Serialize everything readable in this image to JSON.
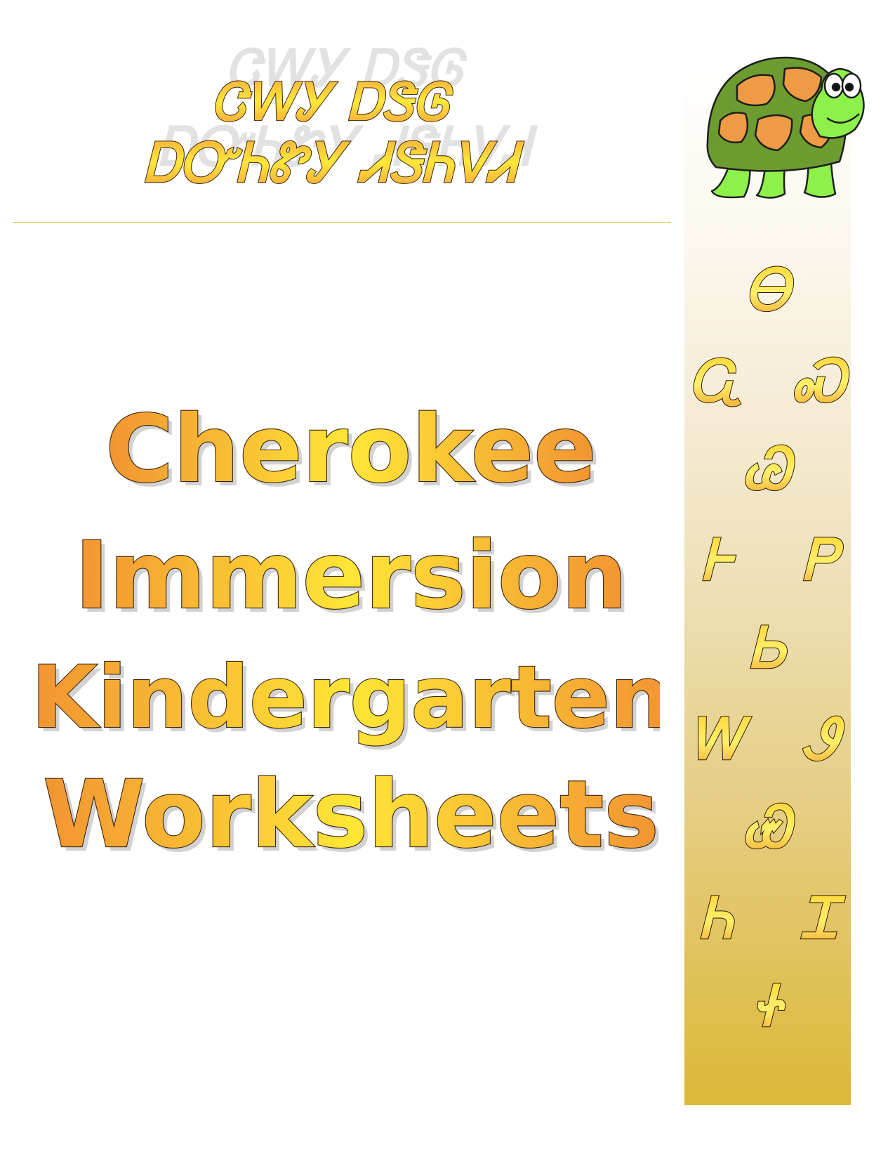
{
  "header": {
    "line1": "ᏣᎳᎩ ᎠᏕᎶ",
    "line2": "ᎠᏅᏂᏑᎩ ᏗᏕᏂᏙᏗ"
  },
  "title": {
    "line1": "Cherokee",
    "line2": "Immersion",
    "line3": "Kindergarten",
    "line4": "Worksheets"
  },
  "sidebar": {
    "glyphs": [
      "Ꮎ",
      "Ꮹ",
      "Ꮝ",
      "Ꮚ",
      "Ꮀ",
      "Ꮲ",
      "Ꮟ",
      "Ꮃ",
      "Ꮽ",
      "Ꮿ",
      "Ꮒ",
      "Ꮖ",
      "Ꮠ"
    ]
  },
  "colors": {
    "gold_light": "#ffe83a",
    "orange": "#f39a3a",
    "outline": "#3a2510",
    "divider": "#e2c860",
    "turtle_shell": "#6c9b2f",
    "turtle_plates": "#ef9a45",
    "turtle_skin": "#8ef04a"
  },
  "icons": {
    "mascot": "turtle-icon"
  }
}
